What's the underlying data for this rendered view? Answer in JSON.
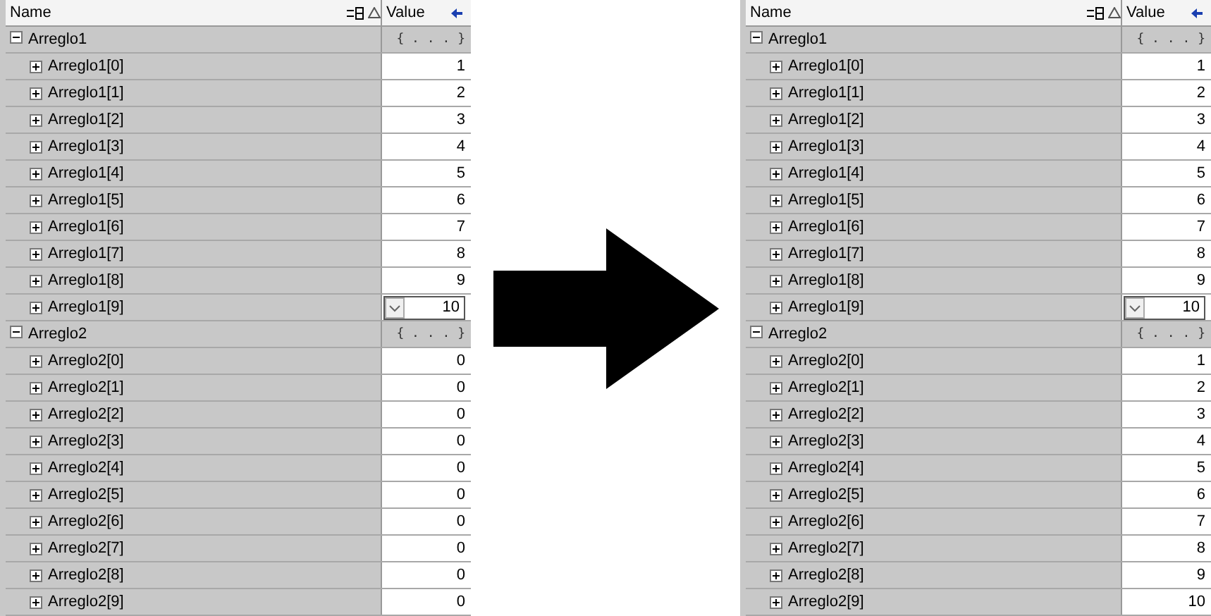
{
  "panels": [
    {
      "header": {
        "name": "Name",
        "value": "Value"
      },
      "groups": [
        {
          "name": "Arreglo1",
          "value": "{ . . . }",
          "expanded": true,
          "children": [
            {
              "name": "Arreglo1[0]",
              "value": "1",
              "editing": false
            },
            {
              "name": "Arreglo1[1]",
              "value": "2",
              "editing": false
            },
            {
              "name": "Arreglo1[2]",
              "value": "3",
              "editing": false
            },
            {
              "name": "Arreglo1[3]",
              "value": "4",
              "editing": false
            },
            {
              "name": "Arreglo1[4]",
              "value": "5",
              "editing": false
            },
            {
              "name": "Arreglo1[5]",
              "value": "6",
              "editing": false
            },
            {
              "name": "Arreglo1[6]",
              "value": "7",
              "editing": false
            },
            {
              "name": "Arreglo1[7]",
              "value": "8",
              "editing": false
            },
            {
              "name": "Arreglo1[8]",
              "value": "9",
              "editing": false
            },
            {
              "name": "Arreglo1[9]",
              "value": "10",
              "editing": true
            }
          ]
        },
        {
          "name": "Arreglo2",
          "value": "{ . . . }",
          "expanded": true,
          "children": [
            {
              "name": "Arreglo2[0]",
              "value": "0",
              "editing": false
            },
            {
              "name": "Arreglo2[1]",
              "value": "0",
              "editing": false
            },
            {
              "name": "Arreglo2[2]",
              "value": "0",
              "editing": false
            },
            {
              "name": "Arreglo2[3]",
              "value": "0",
              "editing": false
            },
            {
              "name": "Arreglo2[4]",
              "value": "0",
              "editing": false
            },
            {
              "name": "Arreglo2[5]",
              "value": "0",
              "editing": false
            },
            {
              "name": "Arreglo2[6]",
              "value": "0",
              "editing": false
            },
            {
              "name": "Arreglo2[7]",
              "value": "0",
              "editing": false
            },
            {
              "name": "Arreglo2[8]",
              "value": "0",
              "editing": false
            },
            {
              "name": "Arreglo2[9]",
              "value": "0",
              "editing": false
            }
          ]
        }
      ]
    },
    {
      "header": {
        "name": "Name",
        "value": "Value"
      },
      "groups": [
        {
          "name": "Arreglo1",
          "value": "{ . . . }",
          "expanded": true,
          "children": [
            {
              "name": "Arreglo1[0]",
              "value": "1",
              "editing": false
            },
            {
              "name": "Arreglo1[1]",
              "value": "2",
              "editing": false
            },
            {
              "name": "Arreglo1[2]",
              "value": "3",
              "editing": false
            },
            {
              "name": "Arreglo1[3]",
              "value": "4",
              "editing": false
            },
            {
              "name": "Arreglo1[4]",
              "value": "5",
              "editing": false
            },
            {
              "name": "Arreglo1[5]",
              "value": "6",
              "editing": false
            },
            {
              "name": "Arreglo1[6]",
              "value": "7",
              "editing": false
            },
            {
              "name": "Arreglo1[7]",
              "value": "8",
              "editing": false
            },
            {
              "name": "Arreglo1[8]",
              "value": "9",
              "editing": false
            },
            {
              "name": "Arreglo1[9]",
              "value": "10",
              "editing": true
            }
          ]
        },
        {
          "name": "Arreglo2",
          "value": "{ . . . }",
          "expanded": true,
          "children": [
            {
              "name": "Arreglo2[0]",
              "value": "1",
              "editing": false
            },
            {
              "name": "Arreglo2[1]",
              "value": "2",
              "editing": false
            },
            {
              "name": "Arreglo2[2]",
              "value": "3",
              "editing": false
            },
            {
              "name": "Arreglo2[3]",
              "value": "4",
              "editing": false
            },
            {
              "name": "Arreglo2[4]",
              "value": "5",
              "editing": false
            },
            {
              "name": "Arreglo2[5]",
              "value": "6",
              "editing": false
            },
            {
              "name": "Arreglo2[6]",
              "value": "7",
              "editing": false
            },
            {
              "name": "Arreglo2[7]",
              "value": "8",
              "editing": false
            },
            {
              "name": "Arreglo2[8]",
              "value": "9",
              "editing": false
            },
            {
              "name": "Arreglo2[9]",
              "value": "10",
              "editing": false
            }
          ]
        }
      ]
    }
  ]
}
